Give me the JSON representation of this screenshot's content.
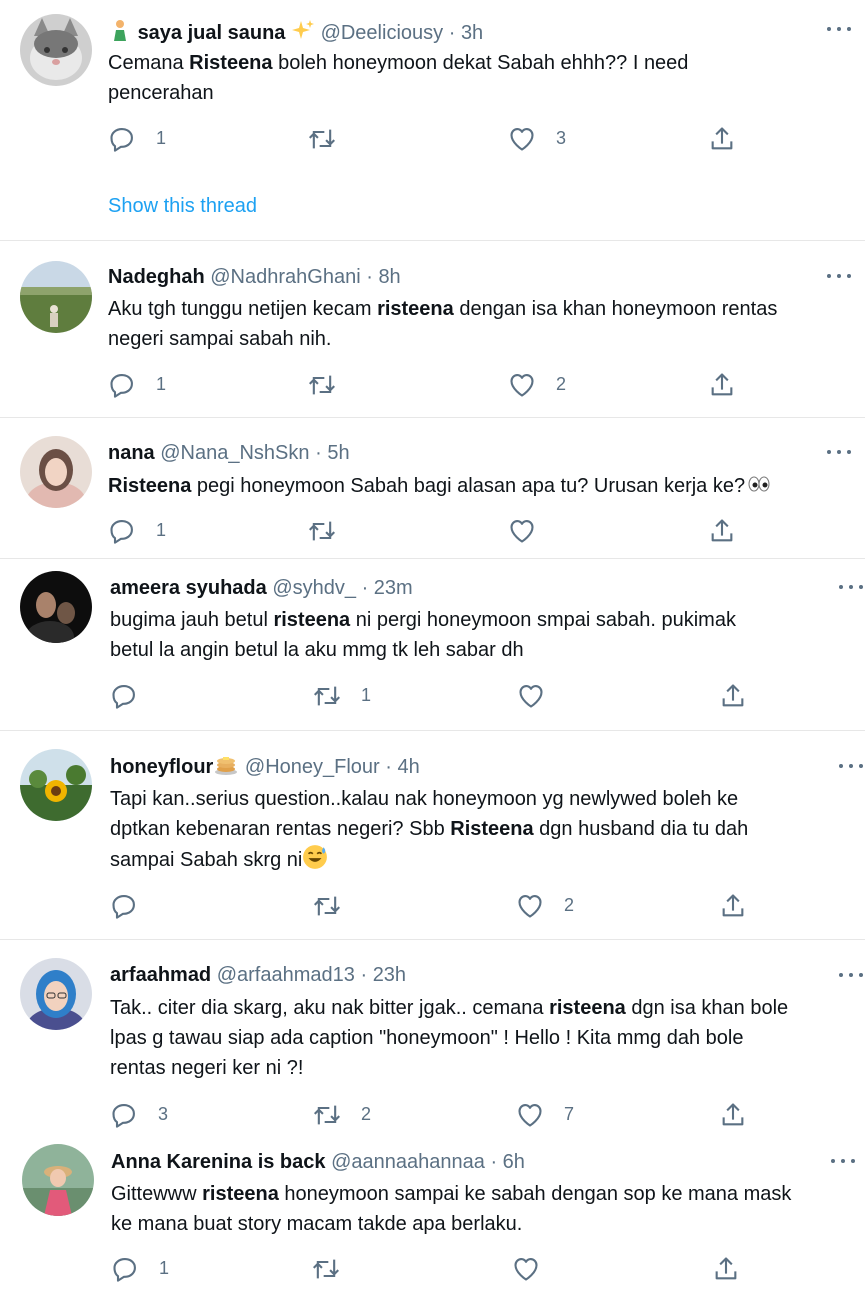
{
  "tweets": [
    {
      "name": "saya jual sauna",
      "handle": "@Deeliciousy",
      "time": "3h",
      "lines": [
        [
          "Cemana ",
          "Risteena",
          " boleh honeymoon dekat Sabah ehhh?? I need"
        ],
        [
          "pencerahan",
          "",
          ""
        ]
      ],
      "reply": "1",
      "retweet": "",
      "like": "3",
      "show_thread": "Show this thread"
    },
    {
      "name": "Nadeghah",
      "handle": "@NadhrahGhani",
      "time": "8h",
      "lines": [
        [
          "Aku tgh tunggu netijen kecam ",
          "risteena",
          " dengan isa khan honeymoon rentas"
        ],
        [
          "negeri sampai sabah nih.",
          "",
          ""
        ]
      ],
      "reply": "1",
      "retweet": "",
      "like": "2"
    },
    {
      "name": "nana",
      "handle": "@Nana_NshSkn",
      "time": "5h",
      "lines": [
        [
          "",
          "Risteena",
          " pegi honeymoon Sabah bagi alasan apa tu? Urusan kerja ke?"
        ]
      ],
      "reply": "1",
      "retweet": "",
      "like": ""
    },
    {
      "name": "ameera syuhada",
      "handle": "@syhdv_",
      "time": "23m",
      "lines": [
        [
          "bugima jauh betul ",
          "risteena",
          " ni pergi honeymoon smpai sabah. pukimak"
        ],
        [
          "betul la angin betul la aku mmg tk leh sabar dh",
          "",
          ""
        ]
      ],
      "reply": "",
      "retweet": "1",
      "like": ""
    },
    {
      "name": "honeyflour",
      "handle": "@Honey_Flour",
      "time": "4h",
      "lines": [
        [
          "Tapi kan..serius question..kalau nak honeymoon yg newlywed boleh ke",
          "",
          ""
        ],
        [
          "dptkan kebenaran rentas negeri? Sbb ",
          "Risteena",
          " dgn husband dia tu dah"
        ],
        [
          "sampai Sabah skrg ni",
          "",
          ""
        ]
      ],
      "reply": "",
      "retweet": "",
      "like": "2"
    },
    {
      "name": "arfaahmad",
      "handle": "@arfaahmad13",
      "time": "23h",
      "lines": [
        [
          "Tak.. citer dia skarg, aku nak bitter jgak.. cemana ",
          "risteena",
          " dgn isa khan bole"
        ],
        [
          "lpas g tawau siap ada caption \"honeymoon\" ! Hello ! Kita mmg dah bole",
          "",
          ""
        ],
        [
          "rentas negeri ker ni ?!",
          "",
          ""
        ]
      ],
      "reply": "3",
      "retweet": "2",
      "like": "7"
    },
    {
      "name": "Anna Karenina is back",
      "handle": "@aannaahannaa",
      "time": "6h",
      "lines": [
        [
          "Gittewww ",
          "risteena",
          " honeymoon sampai ke sabah dengan sop ke mana mask"
        ],
        [
          "ke mana buat story macam takde apa berlaku.",
          "",
          ""
        ]
      ],
      "reply": "1",
      "retweet": "",
      "like": ""
    }
  ],
  "separator": "·",
  "icons": [
    "sparkles-emoji-icon",
    "person-emoji-icon",
    "eyes-emoji-icon",
    "pancake-emoji-icon",
    "sweat-smile-emoji-icon",
    "reply-icon",
    "retweet-icon",
    "like-icon",
    "share-icon",
    "more-icon"
  ],
  "colors": {
    "link": "#1da1f2",
    "secondary": "#5b7083",
    "text": "#0f1419",
    "divider": "#e7e7e7"
  }
}
